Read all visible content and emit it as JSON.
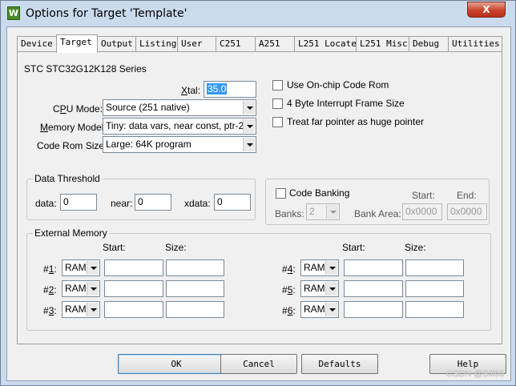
{
  "window": {
    "title": "Options for Target 'Template'",
    "icon_text": "W",
    "close_label": "X"
  },
  "tabs": [
    {
      "label": "Device"
    },
    {
      "label": "Target",
      "active": true
    },
    {
      "label": "Output"
    },
    {
      "label": "Listing"
    },
    {
      "label": "User"
    },
    {
      "label": "C251"
    },
    {
      "label": "A251"
    },
    {
      "label": "L251 Locate"
    },
    {
      "label": "L251 Misc"
    },
    {
      "label": "Debug"
    },
    {
      "label": "Utilities"
    }
  ],
  "target": {
    "series": "STC STC32G12K128 Series",
    "xtal_label_prefix": "",
    "xtal_label_u": "X",
    "xtal_label_rest": "tal:",
    "xtal_value": "35.0",
    "cpu_mode_label_a": "C",
    "cpu_mode_label_u": "P",
    "cpu_mode_label_b": "U Mode:",
    "cpu_mode_value": "Source (251 native)",
    "memory_model_label_u": "M",
    "memory_model_label_rest": "emory Model:",
    "memory_model_value": "Tiny: data vars, near const, ptr-2",
    "code_rom_label": "Code Rom Size:",
    "code_rom_value": "Large: 64K program",
    "options": [
      {
        "label": "Use On-chip Code Rom"
      },
      {
        "label": "4 Byte Interrupt Frame Size"
      },
      {
        "label": "Treat far pointer as huge pointer"
      }
    ]
  },
  "data_threshold": {
    "title": "Data Threshold",
    "data_label": "data:",
    "data_value": "0",
    "near_label": "near:",
    "near_value": "0",
    "xdata_label": "xdata:",
    "xdata_value": "0"
  },
  "code_banking": {
    "label": "Code Banking",
    "banks_label": "Banks:",
    "banks_value": "2",
    "start_label": "Start:",
    "end_label": "End:",
    "bank_area_label": "Bank Area:",
    "bank_start": "0x0000",
    "bank_end": "0x0000"
  },
  "external_memory": {
    "title": "External Memory",
    "start_label": "Start:",
    "size_label": "Size:",
    "rows": [
      {
        "num": "1",
        "type": "RAM"
      },
      {
        "num": "2",
        "type": "RAM"
      },
      {
        "num": "3",
        "type": "RAM"
      },
      {
        "num": "4",
        "type": "RAM"
      },
      {
        "num": "5",
        "type": "RAM"
      },
      {
        "num": "6",
        "type": "RAM"
      }
    ]
  },
  "buttons": {
    "ok": "OK",
    "cancel": "Cancel",
    "defaults": "Defaults",
    "help": "Help"
  },
  "watermark": "CSDN @Bill66"
}
